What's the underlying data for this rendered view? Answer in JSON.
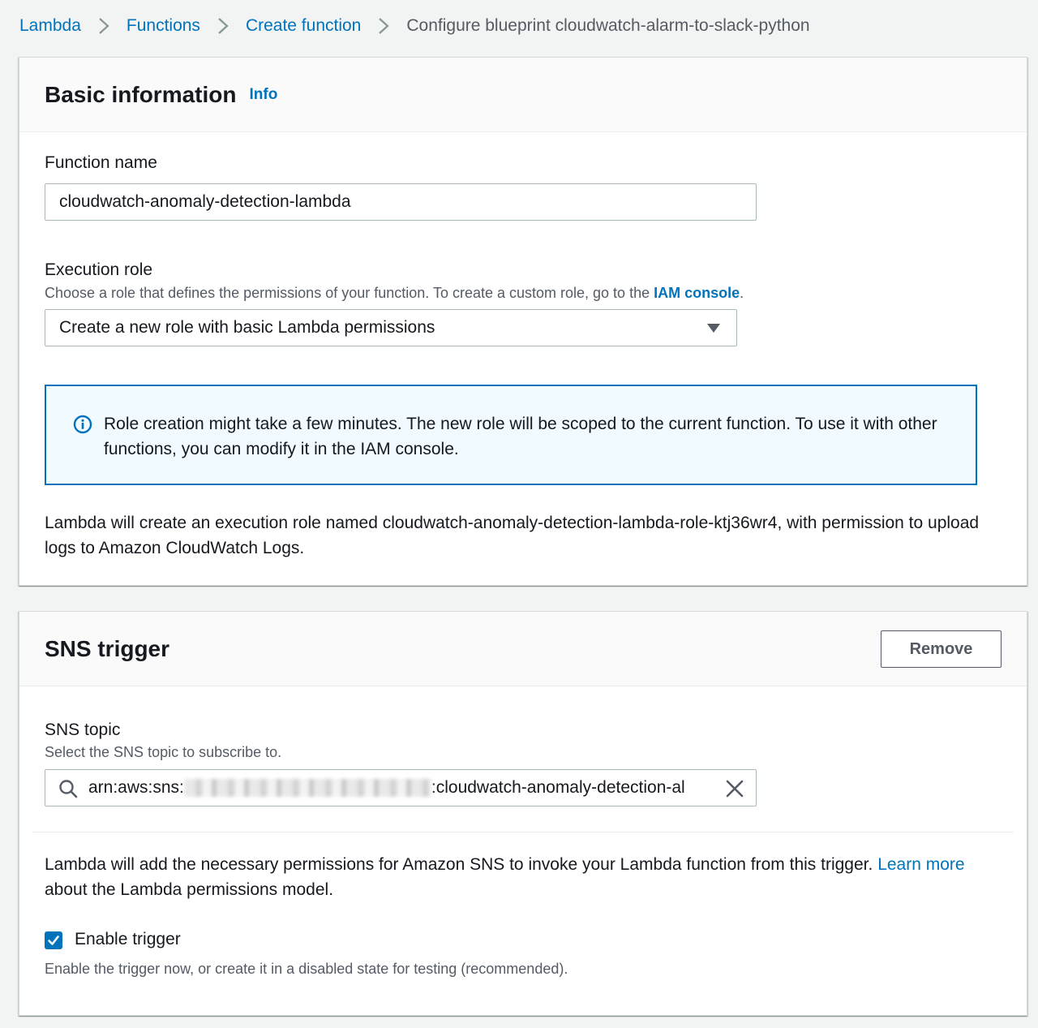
{
  "breadcrumb": {
    "items": [
      {
        "label": "Lambda"
      },
      {
        "label": "Functions"
      },
      {
        "label": "Create function"
      }
    ],
    "current": "Configure blueprint cloudwatch-alarm-to-slack-python"
  },
  "basic_info": {
    "title": "Basic information",
    "info_link": "Info",
    "function_name": {
      "label": "Function name",
      "value": "cloudwatch-anomaly-detection-lambda"
    },
    "execution_role": {
      "label": "Execution role",
      "description": "Choose a role that defines the permissions of your function. To create a custom role, go to the",
      "description_link": "IAM console",
      "description_end": ".",
      "selected": "Create a new role with basic Lambda permissions"
    },
    "alert_text": "Role creation might take a few minutes. The new role will be scoped to the current function. To use it with other functions, you can modify it in the IAM console.",
    "role_note": "Lambda will create an execution role named cloudwatch-anomaly-detection-lambda-role-ktj36wr4, with permission to upload logs to Amazon CloudWatch Logs."
  },
  "sns_trigger": {
    "title": "SNS trigger",
    "remove_label": "Remove",
    "topic": {
      "label": "SNS topic",
      "description": "Select the SNS topic to subscribe to.",
      "value_prefix": "arn:aws:sns:",
      "value_suffix": ":cloudwatch-anomaly-detection-al"
    },
    "permissions_note": "Lambda will add the necessary permissions for Amazon SNS to invoke your Lambda function from this trigger.",
    "learn_more_link": "Learn more",
    "permissions_note_end": "about the Lambda permissions model.",
    "enable_trigger": {
      "label": "Enable trigger",
      "checked": true,
      "description": "Enable the trigger now, or create it in a disabled state for testing (recommended)."
    }
  },
  "colors": {
    "link": "#0073bb",
    "alert_border": "#0073bb",
    "alert_bg": "#f1faff",
    "page_bg": "#f2f3f3"
  }
}
